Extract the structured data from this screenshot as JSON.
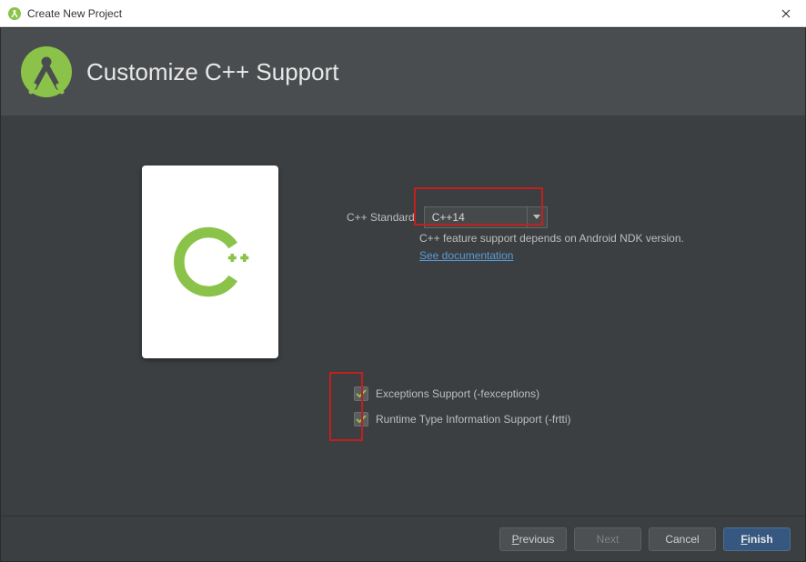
{
  "window": {
    "title": "Create New Project"
  },
  "header": {
    "page_title": "Customize C++ Support"
  },
  "form": {
    "standard_label": "C++ Standard",
    "standard_value": "C++14",
    "help_text": "C++ feature support depends on Android NDK version.",
    "help_link": "See documentation",
    "exceptions_label": "Exceptions Support (-fexceptions)",
    "rtti_label": "Runtime Type Information Support (-frtti)",
    "exceptions_checked": true,
    "rtti_checked": true
  },
  "footer": {
    "previous": "Previous",
    "next": "Next",
    "cancel": "Cancel",
    "finish": "Finish"
  },
  "colors": {
    "accent_green": "#8bc34a",
    "highlight_red": "#c21f1f",
    "link_blue": "#5b9bd5",
    "primary_button": "#365880"
  }
}
